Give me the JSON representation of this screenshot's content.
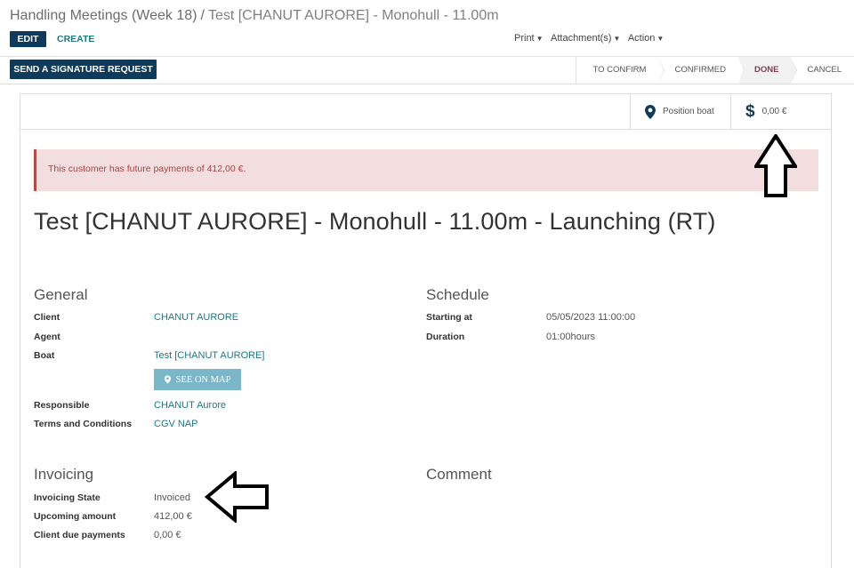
{
  "breadcrumb": {
    "parent": "Handling Meetings (Week 18)",
    "separator": "/",
    "current": "Test [CHANUT AURORE] - Monohull - 11.00m"
  },
  "buttons": {
    "edit": "EDIT",
    "create": "CREATE",
    "send_signature": "SEND A SIGNATURE REQUEST"
  },
  "sidebar": {
    "print": "Print",
    "attachments": "Attachment(s)",
    "action": "Action"
  },
  "status": {
    "stages": [
      "TO CONFIRM",
      "CONFIRMED",
      "DONE",
      "CANCEL"
    ],
    "current": "DONE"
  },
  "stat_buttons": {
    "position": "Position boat",
    "amount": "0,00 €"
  },
  "alert": "This customer has future payments of 412,00 €.",
  "record_title": "Test [CHANUT AURORE] - Monohull - 11.00m - Launching (RT)",
  "general": {
    "title": "General",
    "client_label": "Client",
    "client_value": "CHANUT AURORE",
    "agent_label": "Agent",
    "boat_label": "Boat",
    "boat_value": "Test [CHANUT AURORE]",
    "see_on_map": "SEE ON MAP",
    "responsible_label": "Responsible",
    "responsible_value": "CHANUT Aurore",
    "terms_label": "Terms and Conditions",
    "terms_value": "CGV NAP"
  },
  "schedule": {
    "title": "Schedule",
    "start_label": "Starting at",
    "start_value": "05/05/2023 11:00:00",
    "duration_label": "Duration",
    "duration_value": "01:00hours"
  },
  "invoicing": {
    "title": "Invoicing",
    "state_label": "Invoicing State",
    "state_value": "Invoiced",
    "upcoming_label": "Upcoming amount",
    "upcoming_value": "412,00 €",
    "due_label": "Client due payments",
    "due_value": "0,00 €"
  },
  "comment": {
    "title": "Comment"
  },
  "colors": {
    "primary": "#0d3b5c",
    "link": "#1a7b84",
    "alert_bg": "#f2dede",
    "alert_border": "#b94a48",
    "map_button": "#7cb7c9",
    "active_stage": "#7f3b5a"
  }
}
